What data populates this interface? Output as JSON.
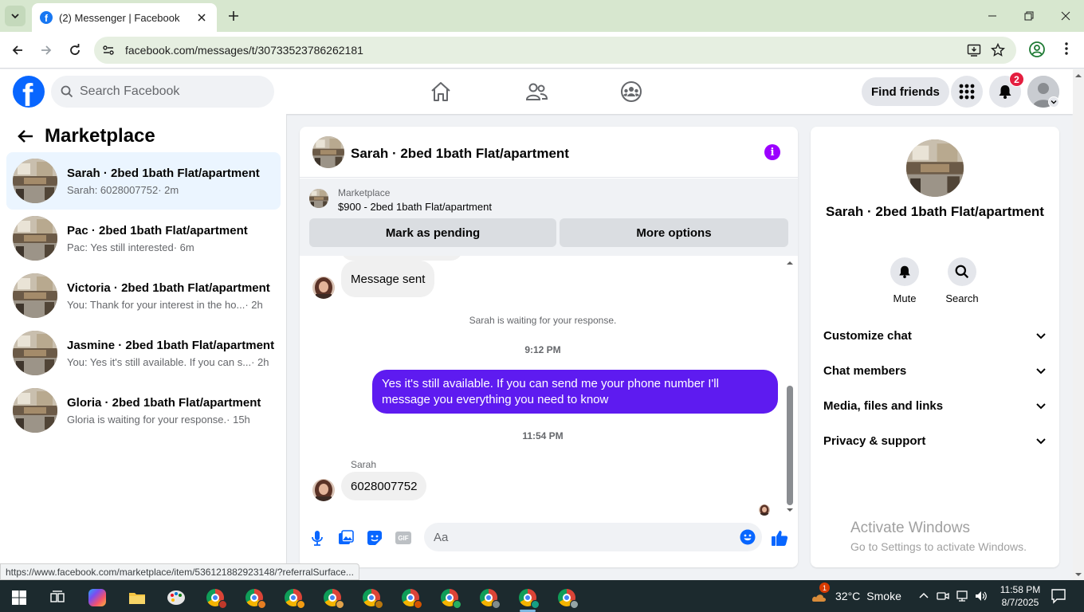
{
  "browser": {
    "tab_title": "(2) Messenger | Facebook",
    "url": "facebook.com/messages/t/30733523786262181",
    "status_url": "https://www.facebook.com/marketplace/item/536121882923148/?referralSurface..."
  },
  "fb_header": {
    "search_placeholder": "Search Facebook",
    "find_friends_label": "Find friends",
    "notification_count": "2"
  },
  "sidebar": {
    "title": "Marketplace",
    "conversations": [
      {
        "title": "Sarah · 2bed 1bath Flat/apartment",
        "preview": "Sarah: 6028007752",
        "time": " · 2m",
        "active": true
      },
      {
        "title": "Pac · 2bed 1bath Flat/apartment",
        "preview": "Pac: Yes still interested",
        "time": " · 6m"
      },
      {
        "title": "Victoria · 2bed 1bath Flat/apartment",
        "preview": "You: Thank for your interest in the ho...",
        "time": " · 2h"
      },
      {
        "title": "Jasmine · 2bed 1bath Flat/apartment",
        "preview": "You: Yes it's still available. If you can s...",
        "time": " · 2h"
      },
      {
        "title": "Gloria · 2bed 1bath Flat/apartment",
        "preview": "Gloria is waiting for your response.",
        "time": " · 15h"
      }
    ]
  },
  "chat": {
    "title": "Sarah · 2bed 1bath Flat/apartment",
    "listing": {
      "source": "Marketplace",
      "title": "$900 - 2bed 1bath Flat/apartment",
      "mark_pending_label": "Mark as pending",
      "more_options_label": "More options"
    },
    "messages": {
      "in_1": "Message sent",
      "waiting": "Sarah is waiting for your response.",
      "time_1": "9:12 PM",
      "out_1": "Yes it's still available. If you can send me your phone number I'll message you everything you need to know",
      "time_2": "11:54 PM",
      "sender": "Sarah",
      "in_2": "6028007752"
    },
    "composer_placeholder": "Aa",
    "gif_label": "GIF"
  },
  "info_panel": {
    "name": "Sarah · 2bed 1bath Flat/apartment",
    "actions": {
      "mute": "Mute",
      "search": "Search"
    },
    "sections": [
      "Customize chat",
      "Chat members",
      "Media, files and links",
      "Privacy & support"
    ]
  },
  "watermark": {
    "title": "Activate Windows",
    "subtitle": "Go to Settings to activate Windows."
  },
  "taskbar": {
    "weather_badge": "1",
    "temperature": "32°C",
    "weather": "Smoke",
    "time": "11:58 PM",
    "date": "8/7/2025"
  },
  "colors": {
    "brand": "#0866ff",
    "outgoing_bubble": "#5e1bf0",
    "info_icon": "#9b00ff",
    "badge": "#e41e3f"
  }
}
